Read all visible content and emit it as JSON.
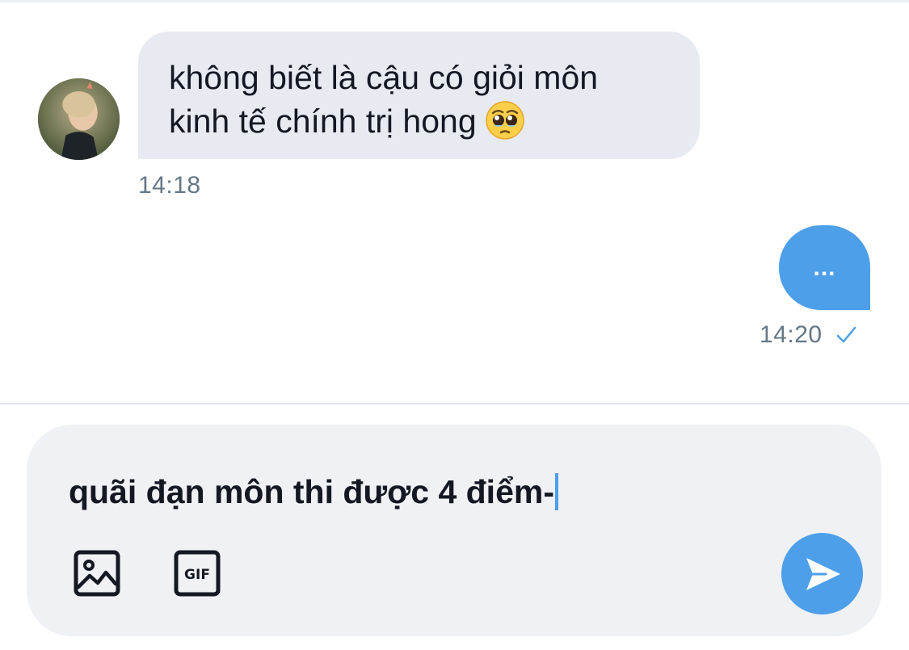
{
  "conversation": {
    "incoming": {
      "lines": [
        "không biết là cậu có giỏi môn",
        "kinh tế chính trị hong"
      ],
      "emoji": "pleading-face",
      "time": "14:18"
    },
    "outgoing": {
      "text": "...",
      "time": "14:20",
      "status_icon": "check-icon"
    }
  },
  "composer": {
    "text": "quãi đạn môn thi được 4 điểm-",
    "tools": [
      "image-icon",
      "gif-icon"
    ],
    "send_icon": "send-icon"
  },
  "colors": {
    "accent": "#4d9fe9",
    "incoming_bubble": "#e8eaf2",
    "composer_bg": "#eff1f4",
    "timestamp": "#657786"
  }
}
